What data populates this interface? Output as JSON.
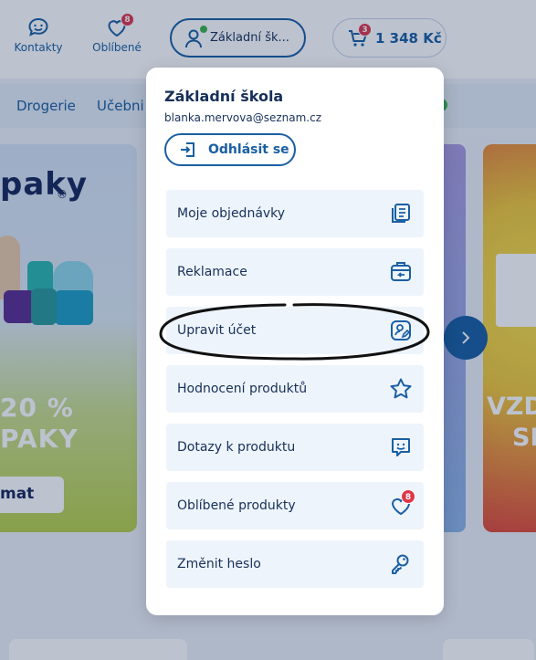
{
  "header": {
    "contacts_label": "Kontakty",
    "favorites_label": "Oblíbené",
    "favorites_count": "8",
    "user_name_short": "Základní šk...",
    "cart_count": "3",
    "cart_price": "1 348 Kč"
  },
  "nav": {
    "items": [
      "Drogerie",
      "Učebni"
    ]
  },
  "banners": {
    "left_logo": "paky",
    "left_logo_mark": "®",
    "left_promo_line1": "20 %",
    "left_promo_line2": "PAKY",
    "left_button": "mat",
    "right_promo_line1": "VZD",
    "right_promo_line2": "SI"
  },
  "account_menu": {
    "title": "Základní škola",
    "email": "blanka.mervova@seznam.cz",
    "logout_label": "Odhlásit se",
    "items": [
      {
        "label": "Moje objednávky",
        "icon": "orders-icon"
      },
      {
        "label": "Reklamace",
        "icon": "complaint-icon"
      },
      {
        "label": "Upravit účet",
        "icon": "edit-account-icon"
      },
      {
        "label": "Hodnocení produktů",
        "icon": "star-icon"
      },
      {
        "label": "Dotazy k produktu",
        "icon": "question-chat-icon"
      },
      {
        "label": "Oblíbené produkty",
        "icon": "heart-icon",
        "badge": "8"
      },
      {
        "label": "Změnit heslo",
        "icon": "key-icon"
      }
    ]
  },
  "colors": {
    "brand_blue": "#1a5fa3",
    "badge_red": "#e0364a",
    "online_green": "#3bb54a",
    "menu_item_bg": "#eef4fb"
  }
}
